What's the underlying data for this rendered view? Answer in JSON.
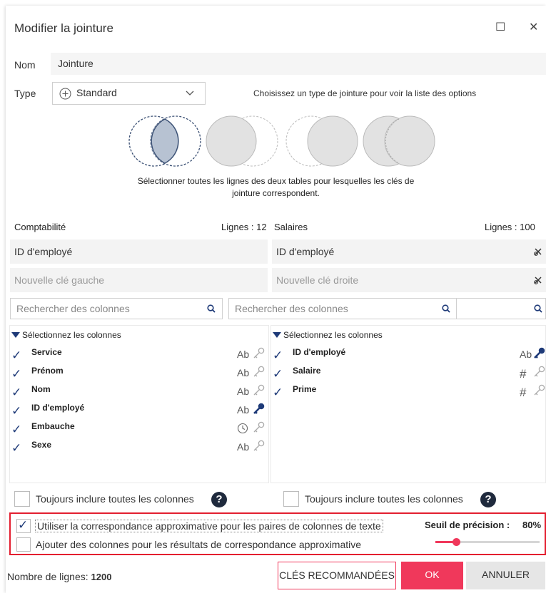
{
  "dialog": {
    "title": "Modifier la jointure",
    "maximize_icon": "☐",
    "close_icon": "✕"
  },
  "name": {
    "label": "Nom",
    "value": "Jointure"
  },
  "type": {
    "label": "Type",
    "value": "Standard",
    "hint": "Choisissez un type de jointure pour voir la liste des options",
    "description_line1": "Sélectionner toutes les lignes des deux tables pour lesquelles les clés de",
    "description_line2": "jointure correspondent."
  },
  "left_table": {
    "name": "Comptabilité",
    "rows_label": "Lignes : 12",
    "key": "ID d'employé",
    "new_key_placeholder": "Nouvelle clé gauche",
    "search_placeholder": "Rechercher des colonnes",
    "select_label": "Sélectionnez les colonnes",
    "columns": [
      {
        "name": "Service",
        "type": "Ab",
        "key_active": false
      },
      {
        "name": "Prénom",
        "type": "Ab",
        "key_active": false
      },
      {
        "name": "Nom",
        "type": "Ab",
        "key_active": false
      },
      {
        "name": "ID d'employé",
        "type": "Ab",
        "key_active": true
      },
      {
        "name": "Embauche",
        "type": "clock",
        "key_active": false
      },
      {
        "name": "Sexe",
        "type": "Ab",
        "key_active": false
      }
    ],
    "include_all_label": "Toujours inclure toutes les colonnes"
  },
  "right_table": {
    "name": "Salaires",
    "rows_label": "Lignes : 100",
    "key": "ID d'employé",
    "new_key_placeholder": "Nouvelle clé droite",
    "search_placeholder": "Rechercher des colonnes",
    "select_label": "Sélectionnez les colonnes",
    "columns": [
      {
        "name": "ID d'employé",
        "type": "Ab",
        "key_active": true
      },
      {
        "name": "Salaire",
        "type": "#",
        "key_active": false
      },
      {
        "name": "Prime",
        "type": "#",
        "key_active": false
      }
    ],
    "include_all_label": "Toujours inclure toutes les colonnes"
  },
  "fuzzy": {
    "use_label": "Utiliser la correspondance approximative pour les paires de colonnes de texte",
    "use_checked": true,
    "add_cols_label": "Ajouter des colonnes pour les résultats de correspondance approximative",
    "add_cols_checked": false,
    "threshold_label": "Seuil de précision :",
    "threshold_value": "80%",
    "threshold_fraction": 0.2
  },
  "footer": {
    "row_count_label": "Nombre de lignes:",
    "row_count_value": "1200",
    "recommended_keys": "CLÉS RECOMMANDÉES",
    "ok": "OK",
    "cancel": "ANNULER"
  },
  "colors": {
    "accent": "#f0385b",
    "check": "#1e3a78",
    "highlight": "#e31e2f"
  }
}
